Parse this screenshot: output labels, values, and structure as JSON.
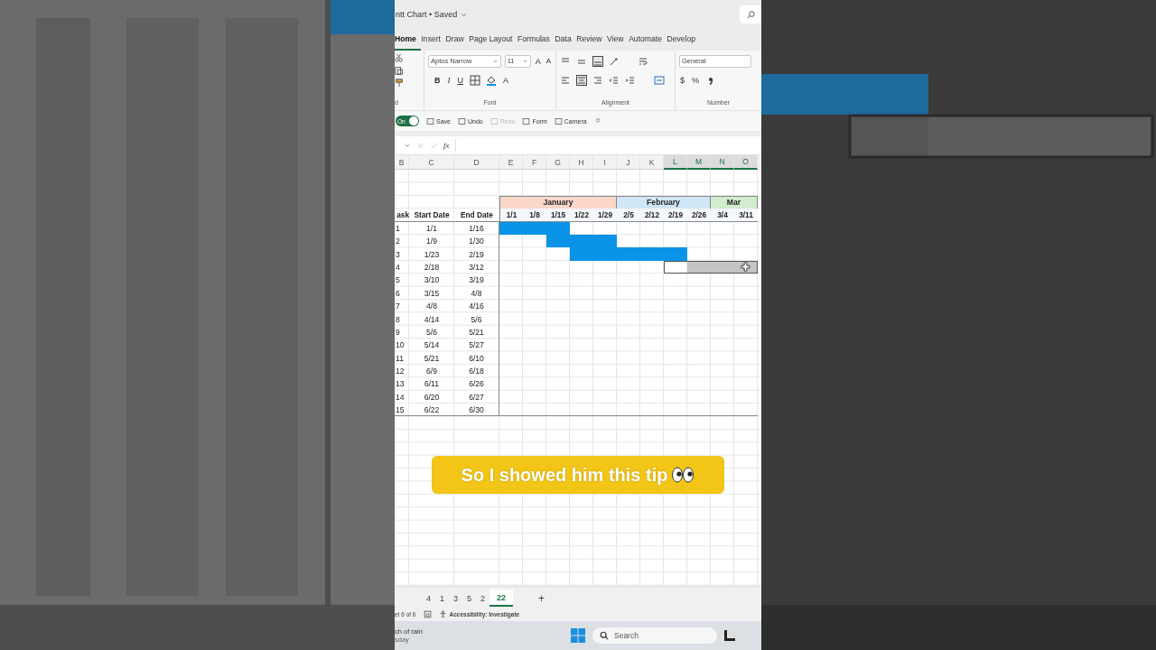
{
  "window": {
    "title": "ntt Chart • Saved"
  },
  "ribbon_tabs": [
    {
      "label": "Home",
      "selected": true
    },
    {
      "label": "Insert",
      "selected": false
    },
    {
      "label": "Draw",
      "selected": false
    },
    {
      "label": "Page Layout",
      "selected": false
    },
    {
      "label": "Formulas",
      "selected": false
    },
    {
      "label": "Data",
      "selected": false
    },
    {
      "label": "Review",
      "selected": false
    },
    {
      "label": "View",
      "selected": false
    },
    {
      "label": "Automate",
      "selected": false
    },
    {
      "label": "Develop",
      "selected": false
    }
  ],
  "ribbon": {
    "clipboard_label": "d",
    "font": {
      "name": "Aptos Narrow",
      "size": "11",
      "grow": "A",
      "shrink": "A",
      "bold": "B",
      "italic": "I",
      "underline": "U",
      "color_button": "A",
      "label": "Font"
    },
    "alignment": {
      "label": "Alignment"
    },
    "number": {
      "format": "General",
      "currency": "$",
      "percent": "%",
      "label": "Number"
    }
  },
  "quick_access": {
    "autosave": {
      "label": "On",
      "on": true
    },
    "items": [
      {
        "label": "Save",
        "disabled": false
      },
      {
        "label": "Undo",
        "disabled": false
      },
      {
        "label": "Redo",
        "disabled": true
      },
      {
        "label": "Form",
        "disabled": false
      },
      {
        "label": "Camera",
        "disabled": false
      }
    ]
  },
  "formula_bar": {
    "fx": "fx"
  },
  "columns": [
    {
      "label": "B",
      "selected": false
    },
    {
      "label": "C",
      "selected": false
    },
    {
      "label": "D",
      "selected": false
    },
    {
      "label": "E",
      "selected": false
    },
    {
      "label": "F",
      "selected": false
    },
    {
      "label": "G",
      "selected": false
    },
    {
      "label": "H",
      "selected": false
    },
    {
      "label": "I",
      "selected": false
    },
    {
      "label": "J",
      "selected": false
    },
    {
      "label": "K",
      "selected": false
    },
    {
      "label": "L",
      "selected": true
    },
    {
      "label": "M",
      "selected": true
    },
    {
      "label": "N",
      "selected": true
    },
    {
      "label": "O",
      "selected": true
    }
  ],
  "headers": [
    "ask",
    "Start Date",
    "End Date"
  ],
  "months": [
    {
      "label": "January",
      "color": "#fad7c9",
      "weeks": [
        "1/1",
        "1/8",
        "1/15",
        "1/22",
        "1/29"
      ]
    },
    {
      "label": "February",
      "color": "#cfe7f6",
      "weeks": [
        "2/5",
        "2/12",
        "2/19",
        "2/26"
      ]
    },
    {
      "label": "Mar",
      "color": "#d3ebcf",
      "weeks": [
        "3/4",
        "3/11"
      ]
    }
  ],
  "tasks": [
    {
      "task": "1",
      "start": "1/1",
      "end": "1/16",
      "cells": [
        {
          "kind": "bar"
        },
        {
          "kind": "bar"
        },
        {
          "kind": "bar"
        },
        {
          "kind": "empty"
        },
        {
          "kind": "empty"
        },
        {
          "kind": "empty"
        },
        {
          "kind": "empty"
        },
        {
          "kind": "empty"
        },
        {
          "kind": "empty"
        },
        {
          "kind": "empty"
        },
        {
          "kind": "empty"
        }
      ]
    },
    {
      "task": "2",
      "start": "1/9",
      "end": "1/30",
      "cells": [
        {
          "kind": "empty"
        },
        {
          "kind": "empty"
        },
        {
          "kind": "bar"
        },
        {
          "kind": "bar"
        },
        {
          "kind": "bar"
        },
        {
          "kind": "empty"
        },
        {
          "kind": "empty"
        },
        {
          "kind": "empty"
        },
        {
          "kind": "empty"
        },
        {
          "kind": "empty"
        },
        {
          "kind": "empty"
        }
      ]
    },
    {
      "task": "3",
      "start": "1/23",
      "end": "2/19",
      "cells": [
        {
          "kind": "empty"
        },
        {
          "kind": "empty"
        },
        {
          "kind": "empty"
        },
        {
          "kind": "bar"
        },
        {
          "kind": "bar"
        },
        {
          "kind": "bar"
        },
        {
          "kind": "bar"
        },
        {
          "kind": "bar"
        },
        {
          "kind": "empty"
        },
        {
          "kind": "empty"
        },
        {
          "kind": "empty"
        }
      ]
    },
    {
      "task": "4",
      "start": "2/18",
      "end": "3/12",
      "cells": [
        {
          "kind": "empty"
        },
        {
          "kind": "empty"
        },
        {
          "kind": "empty"
        },
        {
          "kind": "empty"
        },
        {
          "kind": "empty"
        },
        {
          "kind": "empty"
        },
        {
          "kind": "empty"
        },
        {
          "kind": "selected"
        },
        {
          "kind": "preview"
        },
        {
          "kind": "preview"
        },
        {
          "kind": "preview"
        }
      ]
    },
    {
      "task": "5",
      "start": "3/10",
      "end": "3/19"
    },
    {
      "task": "6",
      "start": "3/15",
      "end": "4/8"
    },
    {
      "task": "7",
      "start": "4/8",
      "end": "4/16"
    },
    {
      "task": "8",
      "start": "4/14",
      "end": "5/6"
    },
    {
      "task": "9",
      "start": "5/6",
      "end": "5/21"
    },
    {
      "task": "10",
      "start": "5/14",
      "end": "5/27"
    },
    {
      "task": "11",
      "start": "5/21",
      "end": "6/10"
    },
    {
      "task": "12",
      "start": "6/9",
      "end": "6/18"
    },
    {
      "task": "13",
      "start": "6/11",
      "end": "6/26"
    },
    {
      "task": "14",
      "start": "6/20",
      "end": "6/27"
    },
    {
      "task": "15",
      "start": "6/22",
      "end": "6/30"
    }
  ],
  "sheet_tabs": [
    {
      "label": "4",
      "selected": false
    },
    {
      "label": "1",
      "selected": false
    },
    {
      "label": "3",
      "selected": false
    },
    {
      "label": "5",
      "selected": false
    },
    {
      "label": "2",
      "selected": false
    },
    {
      "label": "22",
      "selected": true
    }
  ],
  "add_sheet": "+",
  "status_bar": {
    "sheet": "et 6 of 6",
    "accessibility": "Accessibility: Investigate"
  },
  "taskbar": {
    "weather": "ch of rain",
    "day": "sday",
    "search": "Search"
  },
  "caption": {
    "text": "So I showed him this tip"
  }
}
